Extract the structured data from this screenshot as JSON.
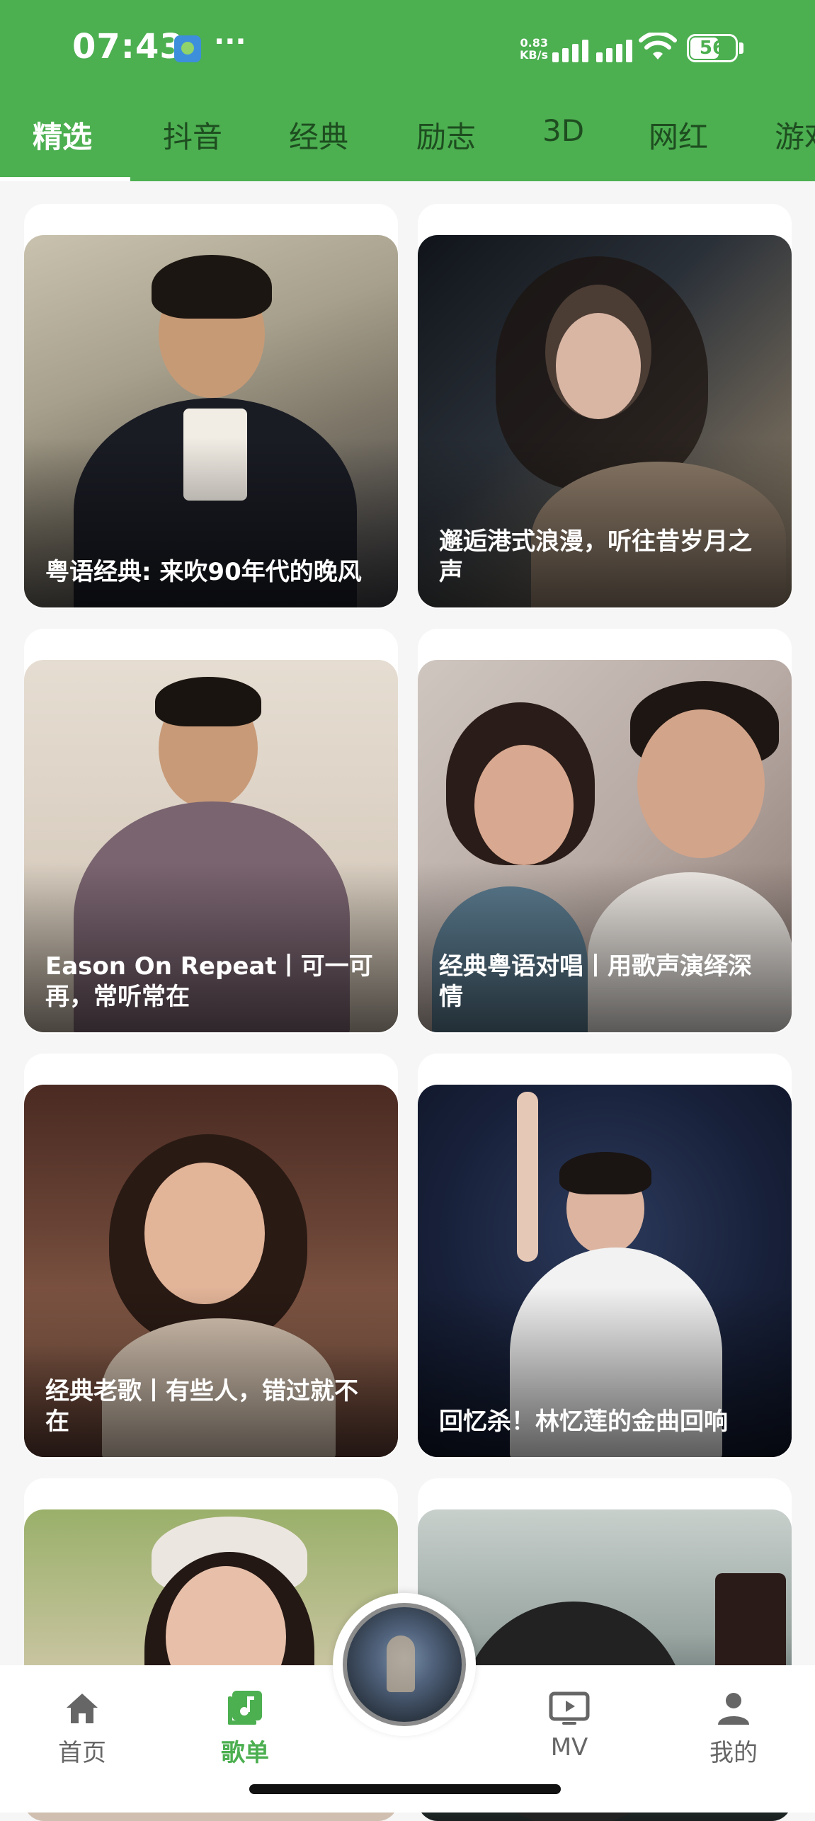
{
  "status_bar": {
    "time": "07:43",
    "more": "···",
    "net_speed": "0.83",
    "net_unit": "KB/s",
    "battery": "56"
  },
  "colors": {
    "accent": "#4caf50",
    "tab_inactive": "#1e4d20"
  },
  "tabs": [
    {
      "label": "精选",
      "active": true
    },
    {
      "label": "抖音"
    },
    {
      "label": "经典"
    },
    {
      "label": "励志"
    },
    {
      "label": "3D"
    },
    {
      "label": "网红"
    },
    {
      "label": "游戏"
    }
  ],
  "playlists": [
    {
      "title": "粤语经典: 来吹90年代的晚风",
      "image": "man-in-tuxedo-photo"
    },
    {
      "title": "邂逅港式浪漫，听往昔岁月之声",
      "image": "woman-long-hair-photo"
    },
    {
      "title": "Eason On Repeat丨可一可再，常听常在",
      "image": "man-purple-shirt-photo"
    },
    {
      "title": "经典粤语对唱丨用歌声演绎深情",
      "image": "duet-couple-photo"
    },
    {
      "title": "经典老歌丨有些人，错过就不在",
      "image": "woman-curly-hair-photo"
    },
    {
      "title": "回忆杀！林忆莲的金曲回响",
      "image": "singer-on-stage-photo"
    },
    {
      "title": "",
      "image": "woman-headband-photo"
    },
    {
      "title": "",
      "image": "turntable-photo"
    }
  ],
  "nav": {
    "home": "首页",
    "playlist": "歌单",
    "mv": "MV",
    "me": "我的"
  }
}
